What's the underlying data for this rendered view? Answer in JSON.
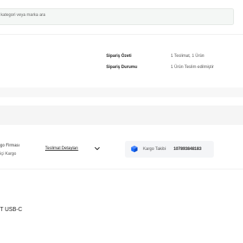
{
  "search": {
    "placeholder": "kategori veya marka ara"
  },
  "order_summary": {
    "summary_label": "Sipariş Özeti",
    "summary_value": "1 Teslimat, 1 Ürün",
    "status_label": "Sipariş Durumu",
    "status_value": "1 Ürün Teslim edilmiştir"
  },
  "shipment": {
    "cargo_firm_label": "go Firması",
    "cargo_firm_name": "içi Kargo",
    "delivery_details_label": "Teslimat Detayları",
    "tracking_label": "Kargo Takibi",
    "tracking_number": "107893848183"
  },
  "product": {
    "title": "T USB-C"
  },
  "icons": {
    "chevron": "chevron-down-icon",
    "tracking": "package-box-icon"
  },
  "colors": {
    "tracking_icon": "#1e6fff"
  }
}
